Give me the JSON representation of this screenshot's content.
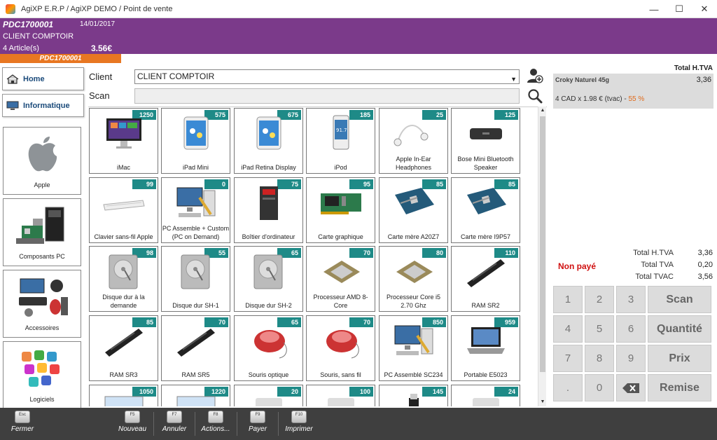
{
  "window": {
    "title": "AgiXP E.R.P  / AgiXP DEMO / Point de vente",
    "minimize": "—",
    "maximize": "☐",
    "close": "✕"
  },
  "header": {
    "ref": "PDC1700001",
    "date": "14/01/2017",
    "client": "CLIENT COMPTOIR",
    "count": "4 Article(s)",
    "total": "3.56€",
    "tab": "PDC1700001"
  },
  "nav": {
    "home": "Home",
    "informatique": "Informatique"
  },
  "categories": [
    "Apple",
    "Composants PC",
    "Accessoires",
    "Logiciels"
  ],
  "form": {
    "client_label": "Client",
    "client_value": "CLIENT COMPTOIR",
    "scan_label": "Scan",
    "scan_value": ""
  },
  "products": [
    {
      "name": "iMac",
      "stock": "1250"
    },
    {
      "name": "iPad Mini",
      "stock": "575"
    },
    {
      "name": "iPad Retina Display",
      "stock": "675"
    },
    {
      "name": "iPod",
      "stock": "185"
    },
    {
      "name": "Apple In-Ear Headphones",
      "stock": "25"
    },
    {
      "name": "Bose Mini Bluetooth Speaker",
      "stock": "125"
    },
    {
      "name": "Clavier sans-fil Apple",
      "stock": "99"
    },
    {
      "name": "PC Assemble + Custom (PC on Demand)",
      "stock": "0"
    },
    {
      "name": "Boîtier d'ordinateur",
      "stock": "75"
    },
    {
      "name": "Carte graphique",
      "stock": "95"
    },
    {
      "name": "Carte mère A20Z7",
      "stock": "85"
    },
    {
      "name": "Carte mère I9P57",
      "stock": "85"
    },
    {
      "name": "Disque dur à la demande",
      "stock": "98"
    },
    {
      "name": "Disque dur SH-1",
      "stock": "55"
    },
    {
      "name": "Disque dur SH-2",
      "stock": "65"
    },
    {
      "name": "Processeur AMD 8-Core",
      "stock": "70"
    },
    {
      "name": "Processeur Core i5 2.70 Ghz",
      "stock": "80"
    },
    {
      "name": "RAM SR2",
      "stock": "110"
    },
    {
      "name": "RAM SR3",
      "stock": "85"
    },
    {
      "name": "RAM SR5",
      "stock": "70"
    },
    {
      "name": "Souris optique",
      "stock": "65"
    },
    {
      "name": "Souris, sans fil",
      "stock": "70"
    },
    {
      "name": "PC Assemblé SC234",
      "stock": "850"
    },
    {
      "name": "Portable E5023",
      "stock": "959"
    },
    {
      "name": "",
      "stock": "1050"
    },
    {
      "name": "",
      "stock": "1220"
    },
    {
      "name": "",
      "stock": "20"
    },
    {
      "name": "",
      "stock": "100"
    },
    {
      "name": "",
      "stock": "145"
    },
    {
      "name": "",
      "stock": "24"
    }
  ],
  "ticket": {
    "header": "Total H.TVA",
    "item": "Croky Naturel 45g",
    "price": "3,36",
    "detail": "4 CAD x 1.98 € (tvac) - ",
    "discount": "55 %"
  },
  "totals": [
    {
      "label": "Total H.TVA",
      "value": "3,36"
    },
    {
      "label": "Total TVA",
      "value": "0,20"
    },
    {
      "label": "Total TVAC",
      "value": "3,56"
    }
  ],
  "status": "Non payé",
  "keypad": {
    "digits": [
      "1",
      "2",
      "3",
      "4",
      "5",
      "6",
      "7",
      "8",
      "9",
      ".",
      "0"
    ],
    "actions": [
      "Scan",
      "Quantité",
      "Prix",
      "Remise"
    ]
  },
  "fkeys": [
    {
      "key": "Esc",
      "label": "Fermer"
    },
    {
      "key": "F5",
      "label": "Nouveau"
    },
    {
      "key": "F7",
      "label": "Annuler"
    },
    {
      "key": "F8",
      "label": "Actions..."
    },
    {
      "key": "F9",
      "label": "Payer"
    },
    {
      "key": "F10",
      "label": "Imprimer"
    }
  ],
  "colors": {
    "header": "#7b3a8a",
    "accent": "#e87722",
    "badge": "#1e8a87",
    "unpaid": "#d01010"
  }
}
